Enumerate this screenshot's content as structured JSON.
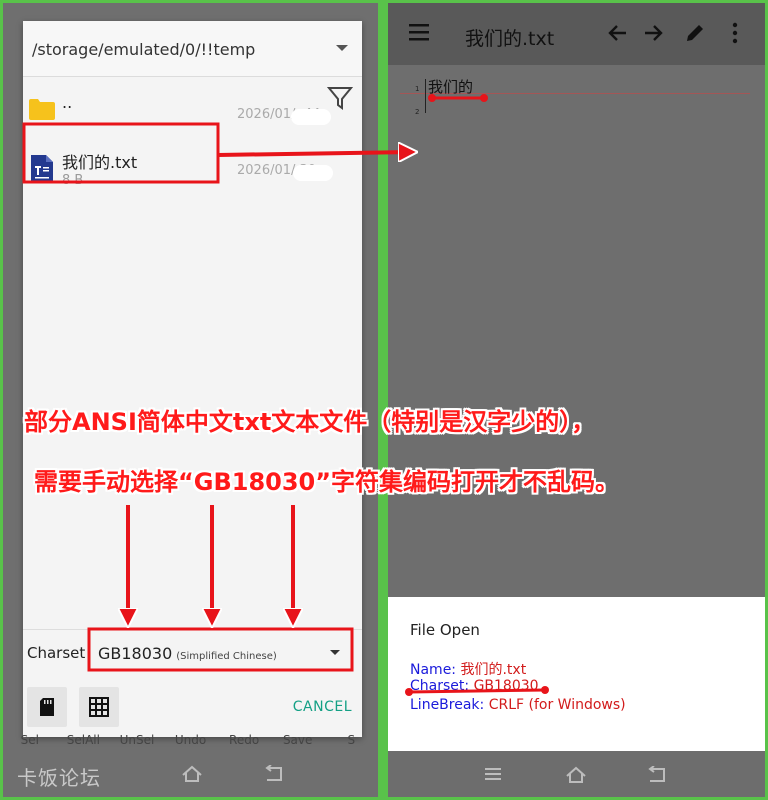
{
  "picker": {
    "path": "/storage/emulated/0/!!temp",
    "parent": {
      "name": "..",
      "date": "2026/01/  :44"
    },
    "file": {
      "name": "我们的.txt",
      "size": "8 B",
      "date": "2026/01/   30"
    },
    "charset_label": "Charset",
    "charset_value": "GB18030",
    "charset_sub": "(Simplified Chinese)",
    "cancel_label": "CANCEL"
  },
  "bottom_toolbar": [
    "Sel",
    "SelAll",
    "UnSel",
    "Undo",
    "Redo",
    "Save",
    "S"
  ],
  "watermark": "卡饭论坛",
  "editor": {
    "title": "我们的.txt",
    "line_numbers": [
      "1",
      "2"
    ],
    "line1": "我们的"
  },
  "file_open": {
    "title": "File Open",
    "name_key": "Name:",
    "name_value": "我们的.txt",
    "charset_key": "Charset:",
    "charset_value": "GB18030",
    "linebreak_key": "LineBreak:",
    "linebreak_value": "CRLF (for Windows)"
  },
  "annotation": {
    "line1": "部分ANSI简体中文txt文本文件（特别是汉字少的），",
    "line2": "需要手动选择“GB18030”字符集编码打开才不乱码。"
  },
  "colors": {
    "frame": "#59c24a",
    "annotation_red": "#e8141a",
    "cancel_teal": "#14a085",
    "info_key_blue": "#1a1adb"
  }
}
